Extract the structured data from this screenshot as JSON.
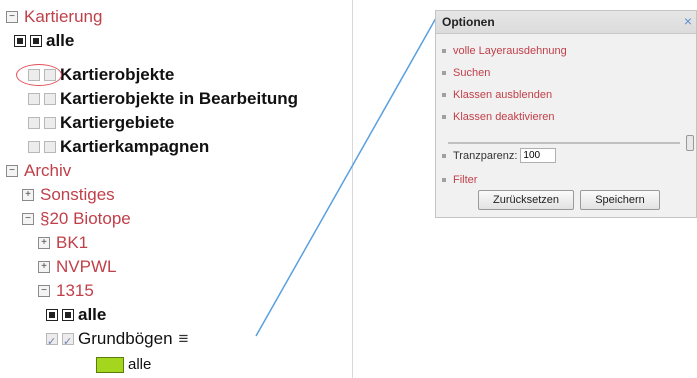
{
  "tree": {
    "kartierung": "Kartierung",
    "alle_top": "alle",
    "kartierobjekte": "Kartierobjekte",
    "kartierobjekte_bearbeitung": "Kartierobjekte in Bearbeitung",
    "kartiergebiete": "Kartiergebiete",
    "kartierkampagnen": "Kartierkampagnen",
    "archiv": "Archiv",
    "sonstiges": "Sonstiges",
    "biotope": "§20 Biotope",
    "bk1": "BK1",
    "nvpwl": "NVPWL",
    "n1315": "1315",
    "alle_sub": "alle",
    "grundboegen": "Grundbögen",
    "legend_alle": "alle",
    "expand_plus": "+",
    "collapse_minus": "−"
  },
  "options": {
    "title": "Optionen",
    "close": "×",
    "items": {
      "full_extent": "volle Layerausdehnung",
      "search": "Suchen",
      "hide_classes": "Klassen ausblenden",
      "deactivate_classes": "Klassen deaktivieren",
      "filter": "Filter"
    },
    "transparency_label": "Tranzparenz:",
    "transparency_value": "100",
    "reset_button": "Zurücksetzen",
    "save_button": "Speichern"
  },
  "colors": {
    "link_red": "#c0404a",
    "legend_green": "#a5d61e",
    "connector_blue": "#5aa0e0",
    "highlight_red": "#e0505a"
  },
  "icons": {
    "menu": "hamburger-menu-icon",
    "expand": "expand-plus-icon",
    "collapse": "collapse-minus-icon",
    "checkbox": "checkbox-icon"
  }
}
